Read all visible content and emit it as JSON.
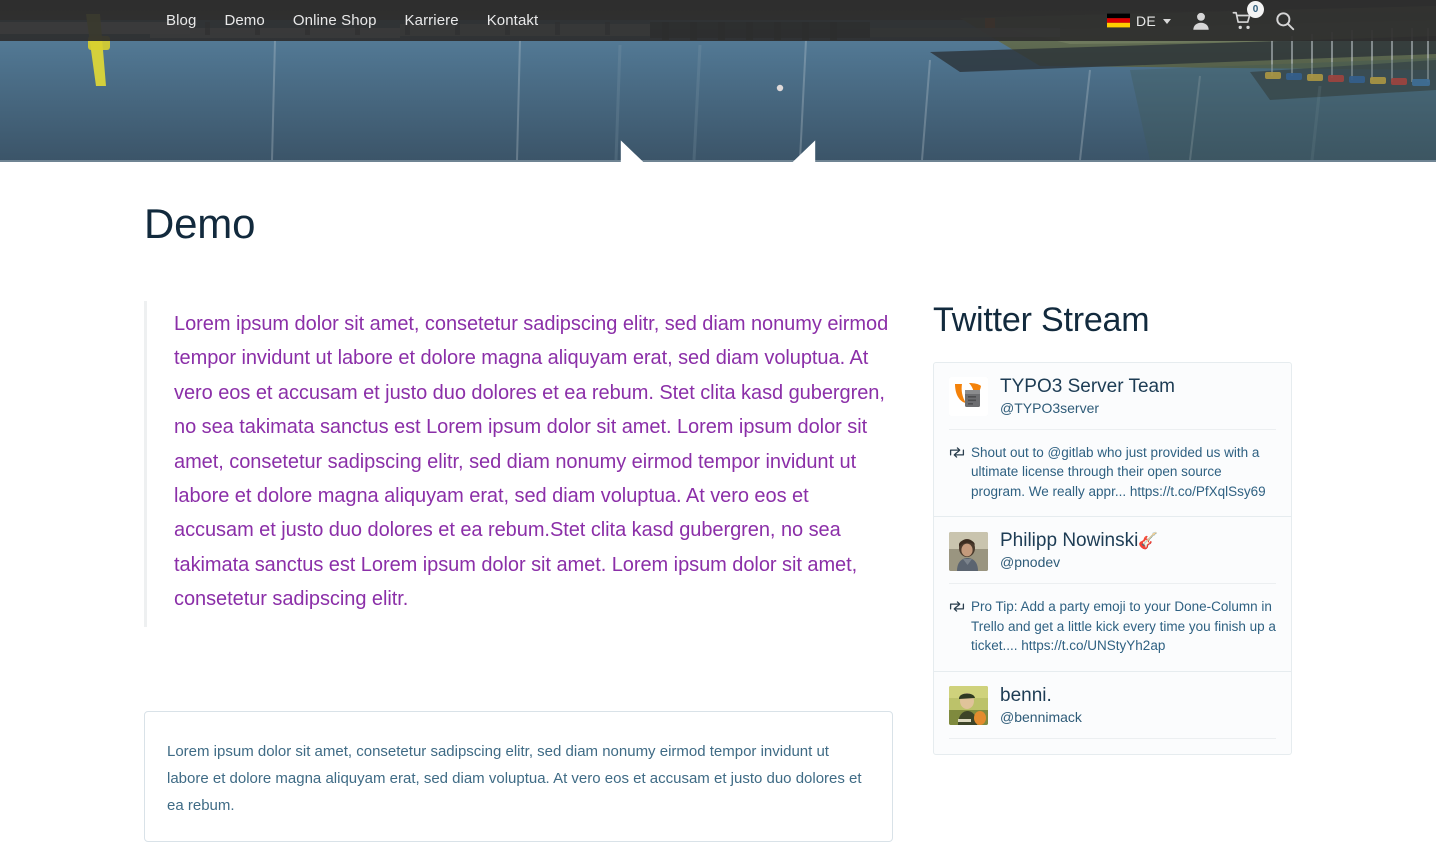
{
  "nav": {
    "items": [
      {
        "label": "Blog",
        "name": "nav-link-blog"
      },
      {
        "label": "Demo",
        "name": "nav-link-demo"
      },
      {
        "label": "Online Shop",
        "name": "nav-link-online-shop"
      },
      {
        "label": "Karriere",
        "name": "nav-link-karriere"
      },
      {
        "label": "Kontakt",
        "name": "nav-link-kontakt"
      }
    ],
    "language": {
      "code": "DE",
      "flag": "german-flag-icon"
    },
    "account_icon": "user-icon",
    "cart_icon": "shopping-cart-icon",
    "cart_count": "0",
    "search_icon": "search-icon",
    "background_color": "#2d2d2d"
  },
  "hero": {
    "image_description": "harbor-marina-photo",
    "scroll_indicator_icon": "chevron-down-icon"
  },
  "main": {
    "title": "Demo",
    "intro_text": "Lorem ipsum dolor sit amet, consetetur sadipscing elitr, sed diam nonumy eirmod tempor invidunt ut labore et dolore magna aliquyam erat, sed diam voluptua. At vero eos et accusam et justo duo dolores et ea rebum. Stet clita kasd gubergren, no sea takimata sanctus est Lorem ipsum dolor sit amet. Lorem ipsum dolor sit amet, consetetur sadipscing elitr, sed diam nonumy eirmod tempor invidunt ut labore et dolore magna aliquyam erat, sed diam voluptua. At vero eos et accusam et justo duo dolores et ea rebum.Stet clita kasd gubergren, no sea takimata sanctus est Lorem ipsum dolor sit amet. Lorem ipsum dolor sit amet, consetetur sadipscing elitr.",
    "intro_text_color": "#8b2fa8",
    "boxed_text": "Lorem ipsum dolor sit amet, consetetur sadipscing elitr, sed diam nonumy eirmod tempor invidunt ut labore et dolore magna aliquyam erat, sed diam voluptua. At vero eos et accusam et justo duo dolores et ea rebum.",
    "boxed_text_color": "#3f6b85"
  },
  "sidebar": {
    "title": "Twitter Stream",
    "tweets": [
      {
        "name": "TYPO3 Server Team",
        "handle": "@TYPO3server",
        "avatar": "typo3-server-logo-avatar",
        "retweet_icon": "retweet-icon",
        "text": "Shout out to @gitlab who just provided us with a ultimate license through their open source program. We really appr... https://t.co/PfXqlSsy69"
      },
      {
        "name": "Philipp Nowinski",
        "name_emoji": "🎸",
        "handle": "@pnodev",
        "avatar": "philipp-nowinski-photo-avatar",
        "retweet_icon": "retweet-icon",
        "text": "Pro Tip: Add a party emoji to your Done-Column in Trello and get a little kick every time you finish up a ticket.... https://t.co/UNStyYh2ap"
      },
      {
        "name": "benni.",
        "handle": "@bennimack",
        "avatar": "benni-photo-avatar",
        "retweet_icon": "retweet-icon",
        "text": ""
      }
    ]
  }
}
